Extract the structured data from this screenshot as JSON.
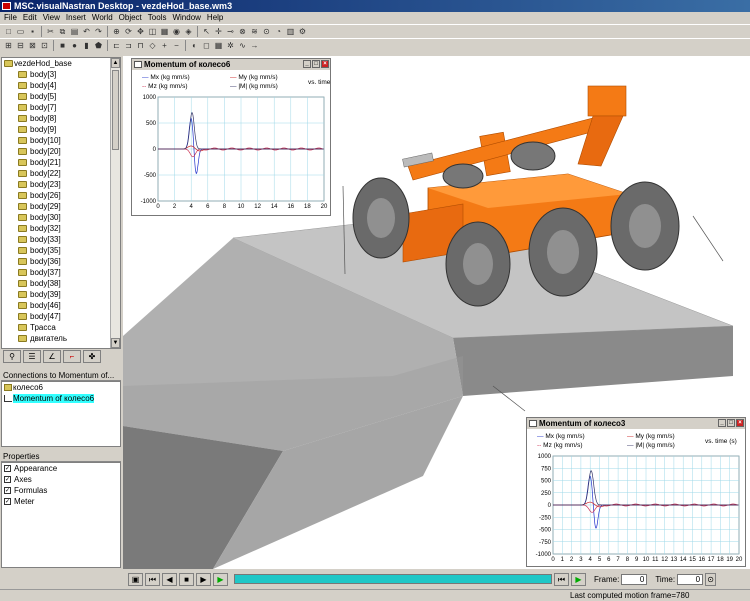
{
  "window": {
    "title": "MSC.visualNastran Desktop - vezdeHod_base.wm3"
  },
  "menu": [
    "File",
    "Edit",
    "View",
    "Insert",
    "World",
    "Object",
    "Tools",
    "Window",
    "Help"
  ],
  "tree": {
    "root": "vezdeHod_base",
    "items": [
      "body[3]",
      "body[4]",
      "body[5]",
      "body[7]",
      "body[8]",
      "body[9]",
      "body[10]",
      "body[20]",
      "body[21]",
      "body[22]",
      "body[23]",
      "body[26]",
      "body[29]",
      "body[30]",
      "body[32]",
      "body[33]",
      "body[35]",
      "body[36]",
      "body[37]",
      "body[38]",
      "body[39]",
      "body[46]",
      "body[47]",
      "Трасса",
      "двигатель"
    ]
  },
  "connections": {
    "header": "Connections to Momentum of...",
    "items": [
      "колесо6",
      "Momentum of колесо6"
    ]
  },
  "properties": {
    "header": "Properties",
    "items": [
      "Appearance",
      "Axes",
      "Formulas",
      "Meter"
    ]
  },
  "graph1": {
    "title": "Momentum of колесо6",
    "legend": {
      "mx": "Mx (kg mm/s)",
      "my": "My (kg mm/s)",
      "mz": "Mz (kg mm/s)",
      "abs": "|M| (kg mm/s)",
      "vs": "vs. time"
    }
  },
  "graph2": {
    "title": "Momentum of колесо3",
    "legend": {
      "mx": "Mx (kg mm/s)",
      "my": "My (kg mm/s)",
      "mz": "Mz (kg mm/s)",
      "abs": "|M| (kg mm/s)",
      "vs": "vs. time (s)"
    }
  },
  "chart_data": [
    {
      "type": "line",
      "title": "Momentum of колесо6",
      "xlim": [
        0,
        20
      ],
      "ylim": [
        -1000,
        1000
      ],
      "xticks": [
        0,
        2,
        4,
        6,
        8,
        10,
        12,
        14,
        16,
        18,
        20
      ],
      "yticks": [
        1000,
        500,
        0,
        -500,
        -1000
      ],
      "colors": {
        "mx": "#2233cc",
        "my": "#cc2222",
        "mz": "#cc3355",
        "abs": "#333366"
      }
    },
    {
      "type": "line",
      "title": "Momentum of колесо3",
      "xlim": [
        0,
        20
      ],
      "ylim": [
        -1000,
        1000
      ],
      "xticks": [
        0,
        1,
        2,
        3,
        4,
        5,
        6,
        7,
        8,
        9,
        10,
        11,
        12,
        13,
        14,
        15,
        16,
        17,
        18,
        19,
        20
      ],
      "yticks": [
        1000,
        750,
        500,
        250,
        0,
        -250,
        -500,
        -750,
        -1000
      ],
      "colors": {
        "mx": "#2233cc",
        "my": "#cc2222",
        "mz": "#cc3355",
        "abs": "#333366"
      }
    }
  ],
  "animation": {
    "frame_label": "Frame:",
    "frame_value": "0",
    "time_label": "Time:",
    "time_value": "0"
  },
  "status": {
    "message": "Last computed motion frame=780"
  }
}
